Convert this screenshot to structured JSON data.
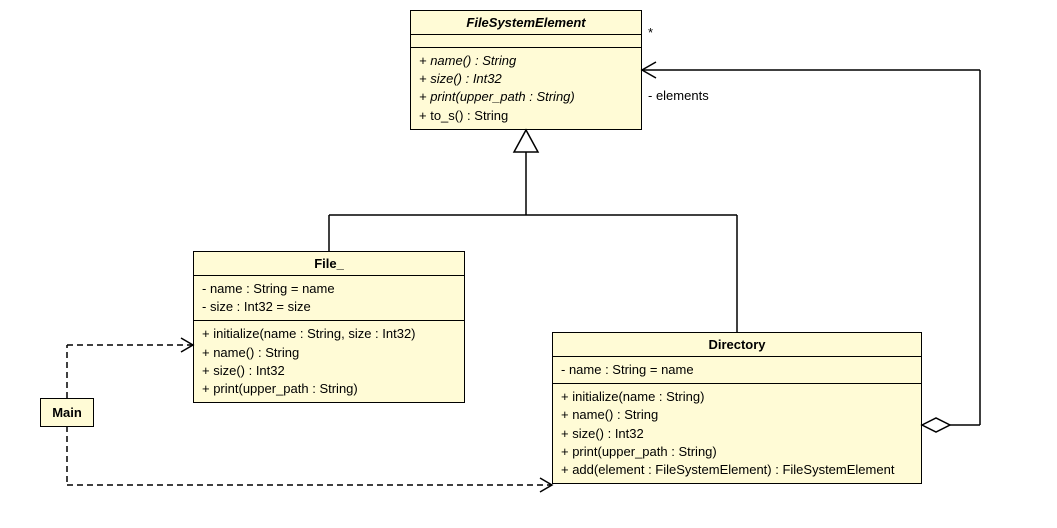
{
  "chart_data": {
    "type": "diagram",
    "diagram_kind": "uml_class",
    "classes": [
      {
        "id": "FileSystemElement",
        "name": "FileSystemElement",
        "abstract": true,
        "attributes": [],
        "methods": [
          {
            "sig": "+ name() : String",
            "abstract": true
          },
          {
            "sig": "+ size() : Int32",
            "abstract": true
          },
          {
            "sig": "+ print(upper_path : String)",
            "abstract": true
          },
          {
            "sig": "+ to_s() : String",
            "abstract": false
          }
        ]
      },
      {
        "id": "File_",
        "name": "File_",
        "abstract": false,
        "attributes": [
          "- name : String = name",
          "- size : Int32 = size"
        ],
        "methods": [
          {
            "sig": "+ initialize(name : String, size : Int32)",
            "abstract": false
          },
          {
            "sig": "+ name() : String",
            "abstract": false
          },
          {
            "sig": "+ size() : Int32",
            "abstract": false
          },
          {
            "sig": "+ print(upper_path : String)",
            "abstract": false
          }
        ]
      },
      {
        "id": "Directory",
        "name": "Directory",
        "abstract": false,
        "attributes": [
          "- name : String = name"
        ],
        "methods": [
          {
            "sig": "+ initialize(name : String)",
            "abstract": false
          },
          {
            "sig": "+ name() : String",
            "abstract": false
          },
          {
            "sig": "+ size() : Int32",
            "abstract": false
          },
          {
            "sig": "+ print(upper_path : String)",
            "abstract": false
          },
          {
            "sig": "+ add(element : FileSystemElement) : FileSystemElement",
            "abstract": false
          }
        ]
      },
      {
        "id": "Main",
        "name": "Main",
        "abstract": false,
        "attributes": [],
        "methods": []
      }
    ],
    "relations": [
      {
        "type": "generalization",
        "from": "File_",
        "to": "FileSystemElement"
      },
      {
        "type": "generalization",
        "from": "Directory",
        "to": "FileSystemElement"
      },
      {
        "type": "aggregation",
        "container": "Directory",
        "part": "FileSystemElement",
        "role": "elements",
        "multiplicity": "*"
      },
      {
        "type": "dependency",
        "from": "Main",
        "to": "File_"
      },
      {
        "type": "dependency",
        "from": "Main",
        "to": "Directory"
      }
    ]
  },
  "fse": {
    "title": "FileSystemElement",
    "m1": "+ name() : String",
    "m2": "+ size() : Int32",
    "m3": "+ print(upper_path : String)",
    "m4": "+ to_s() : String"
  },
  "file": {
    "title": "File_",
    "a1": "- name : String = name",
    "a2": "- size : Int32 = size",
    "m1": "+ initialize(name : String, size : Int32)",
    "m2": "+ name() : String",
    "m3": "+ size() : Int32",
    "m4": "+ print(upper_path : String)"
  },
  "dir": {
    "title": "Directory",
    "a1": "- name : String = name",
    "m1": "+ initialize(name : String)",
    "m2": "+ name() : String",
    "m3": "+ size() : Int32",
    "m4": "+ print(upper_path : String)",
    "m5": "+ add(element : FileSystemElement) : FileSystemElement"
  },
  "main": {
    "title": "Main"
  },
  "labels": {
    "star": "*",
    "elements": "- elements"
  }
}
